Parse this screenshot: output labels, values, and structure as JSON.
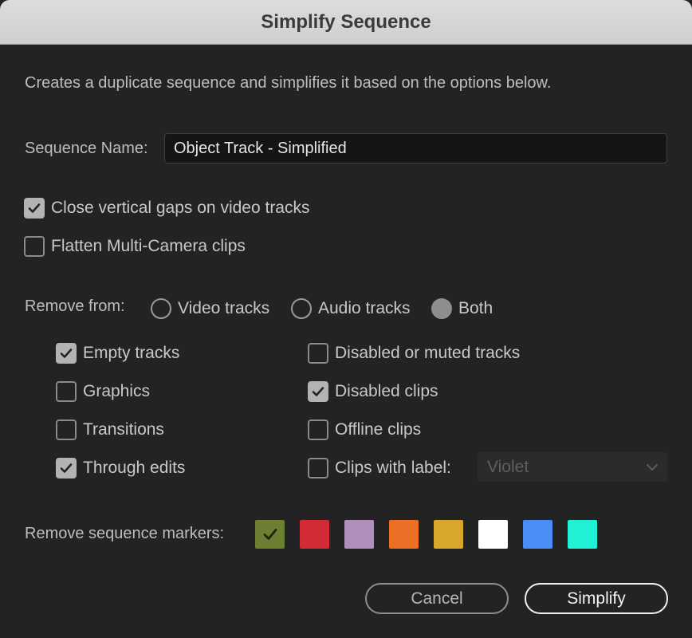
{
  "window": {
    "title": "Simplify Sequence"
  },
  "description": "Creates a duplicate sequence and simplifies it based on the options below.",
  "sequence_name": {
    "label": "Sequence Name:",
    "value": "Object Track - Simplified"
  },
  "options": {
    "close_gaps": {
      "label": "Close vertical gaps on video tracks",
      "checked": true
    },
    "flatten_multicam": {
      "label": "Flatten Multi-Camera clips",
      "checked": false
    }
  },
  "remove_from": {
    "label": "Remove from:",
    "radios": [
      {
        "label": "Video tracks",
        "selected": false
      },
      {
        "label": "Audio tracks",
        "selected": false
      },
      {
        "label": "Both",
        "selected": true
      }
    ]
  },
  "remove_items": {
    "left": [
      {
        "label": "Empty tracks",
        "checked": true
      },
      {
        "label": "Graphics",
        "checked": false
      },
      {
        "label": "Transitions",
        "checked": false
      },
      {
        "label": "Through edits",
        "checked": true
      }
    ],
    "right": [
      {
        "label": "Disabled or muted tracks",
        "checked": false
      },
      {
        "label": "Disabled clips",
        "checked": true
      },
      {
        "label": "Offline clips",
        "checked": false
      },
      {
        "label": "Clips with label:",
        "checked": false
      }
    ],
    "label_select": {
      "value": "Violet"
    }
  },
  "markers": {
    "label": "Remove sequence markers:",
    "swatches": [
      {
        "name": "green",
        "color": "#6c7f33",
        "checked": true
      },
      {
        "name": "red",
        "color": "#d22b35",
        "checked": false
      },
      {
        "name": "violet",
        "color": "#b18fbc",
        "checked": false
      },
      {
        "name": "orange",
        "color": "#ec6f25",
        "checked": false
      },
      {
        "name": "yellow",
        "color": "#d8a629",
        "checked": false
      },
      {
        "name": "white",
        "color": "#ffffff",
        "checked": false
      },
      {
        "name": "blue",
        "color": "#4a8df7",
        "checked": false
      },
      {
        "name": "cyan",
        "color": "#22f0d4",
        "checked": false
      }
    ]
  },
  "buttons": {
    "cancel": "Cancel",
    "confirm": "Simplify"
  }
}
